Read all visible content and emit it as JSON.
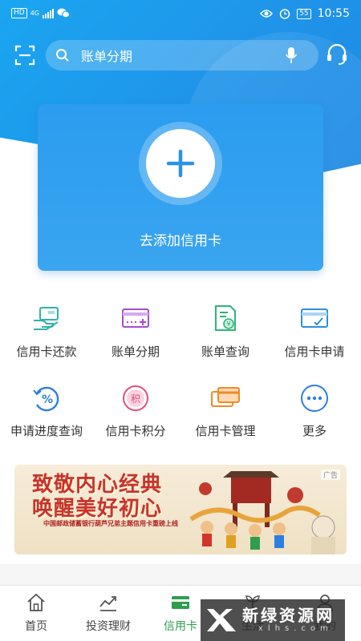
{
  "status_bar": {
    "hd": "HD",
    "network": "4G",
    "battery": "55",
    "time": "10:55"
  },
  "header": {
    "search_placeholder": "账单分期",
    "icons": [
      "scan-icon",
      "search-icon",
      "mic-icon",
      "headset-icon"
    ]
  },
  "add_card": {
    "label": "去添加信用卡"
  },
  "functions": [
    {
      "label": "信用卡还款",
      "icon": "card-repay-icon",
      "color": "#2fb3a6"
    },
    {
      "label": "账单分期",
      "icon": "bill-installment-icon",
      "color": "#a94bd0"
    },
    {
      "label": "账单查询",
      "icon": "bill-query-icon",
      "color": "#2fb37a"
    },
    {
      "label": "信用卡申请",
      "icon": "card-apply-icon",
      "color": "#2c8fe0"
    },
    {
      "label": "申请进度查询",
      "icon": "progress-query-icon",
      "color": "#2c7fe0"
    },
    {
      "label": "信用卡积分",
      "icon": "points-icon",
      "color": "#e0507a"
    },
    {
      "label": "信用卡管理",
      "icon": "card-manage-icon",
      "color": "#f08a2a"
    },
    {
      "label": "更多",
      "icon": "more-icon",
      "color": "#2c7fe0"
    }
  ],
  "banner": {
    "title_line1": "致敬内心经典",
    "title_line2": "唤醒美好初心",
    "subtitle": "中国邮政储蓄银行葫芦兄弟主题信用卡重磅上线",
    "ad_tag": "广告"
  },
  "bottom_nav": {
    "items": [
      {
        "label": "首页",
        "icon": "home-icon"
      },
      {
        "label": "投资理财",
        "icon": "invest-icon"
      },
      {
        "label": "信用卡",
        "icon": "credit-card-icon",
        "active": true
      },
      {
        "label": "生活",
        "icon": "life-icon"
      },
      {
        "label": "我的",
        "icon": "profile-icon"
      }
    ],
    "active_color": "#2e9e4c"
  },
  "watermark": {
    "text": "新绿资源网",
    "sub": "xlhs.com"
  },
  "colors": {
    "brand_blue": "#1f95ea",
    "brand_green": "#2e9e4c"
  }
}
